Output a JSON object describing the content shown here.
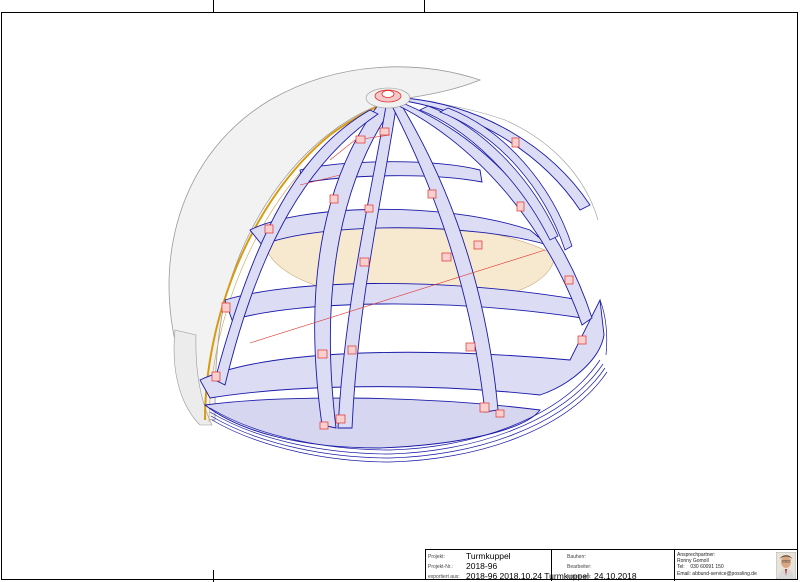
{
  "title_block": {
    "project_label": "Projekt:",
    "project_value": "Turmkuppel",
    "project_no_label": "Projekt-Nr.:",
    "project_no_value": "2018-96",
    "exported_from_label": "exportiert aus:",
    "exported_from_value": "2018-96 2018.10.24 Turmkuppel",
    "date_label": "erstellt am:",
    "date_value": "24.10.2018",
    "client_label": "Bauherr:",
    "editor_label": "Bearbeiter:",
    "contact_title": "Ansprechpartner:",
    "contact_name": "Ronny Gomoll",
    "contact_phone_label": "Tel:",
    "contact_phone": "030 60091 150",
    "contact_email_label": "Email:",
    "contact_email": "abbund-service@possling.de"
  },
  "colors": {
    "rib_fill": "#dcdcf4",
    "rib_stroke": "#1a1aa8",
    "connector": "#e0302a",
    "shell": "#f2f2f2",
    "shell_stroke": "#9a9a9a",
    "inner_floor": "#f7e9d0",
    "edge_gold": "#d89a10"
  },
  "icons": [
    "contact-photo"
  ]
}
